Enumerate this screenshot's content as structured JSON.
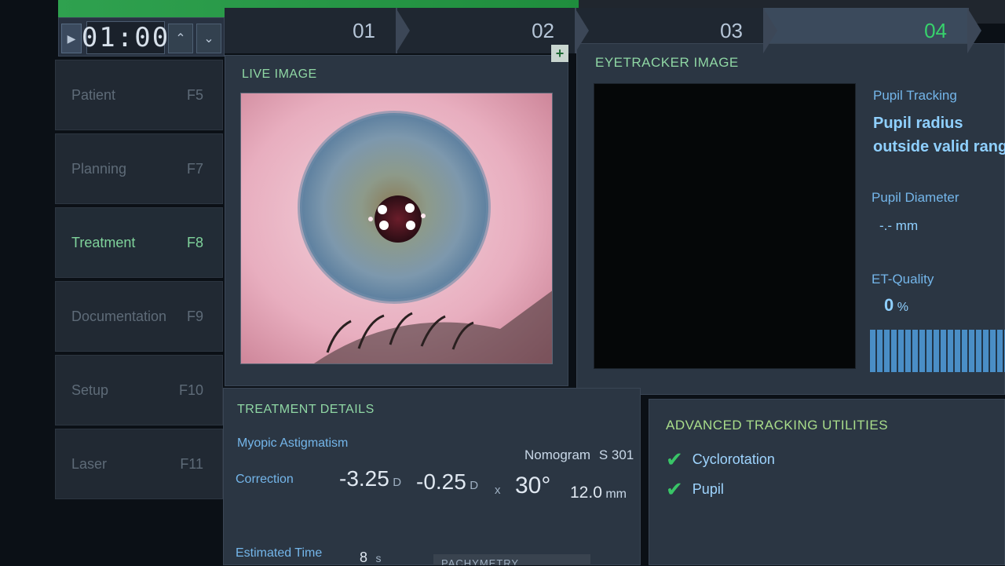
{
  "timer": {
    "value": "01:00",
    "play_icon": "play-icon",
    "up_icon": "chevron-up-icon",
    "down_icon": "chevron-down-icon"
  },
  "progress": {
    "fraction": 0.55
  },
  "steps": [
    {
      "label": "01"
    },
    {
      "label": "02"
    },
    {
      "label": "03"
    },
    {
      "label": "04"
    }
  ],
  "sidebar": {
    "items": [
      {
        "label": "Patient",
        "key": "F5"
      },
      {
        "label": "Planning",
        "key": "F7"
      },
      {
        "label": "Treatment",
        "key": "F8"
      },
      {
        "label": "Documentation",
        "key": "F9"
      },
      {
        "label": "Setup",
        "key": "F10"
      },
      {
        "label": "Laser",
        "key": "F11"
      }
    ],
    "active": "Treatment"
  },
  "live_image": {
    "title": "LIVE IMAGE",
    "plus_label": "+"
  },
  "eyetracker": {
    "title": "EYETRACKER IMAGE",
    "pupil_tracking_label": "Pupil Tracking",
    "pupil_tracking_status_1": "Pupil radius",
    "pupil_tracking_status_2": "outside valid range",
    "pupil_diameter_label": "Pupil Diameter",
    "pupil_diameter_value": "-.-",
    "pupil_diameter_unit": "mm",
    "et_quality_label": "ET-Quality",
    "et_quality_value": "0",
    "et_quality_unit": "%"
  },
  "treatment": {
    "title": "TREATMENT DETAILS",
    "type": "Myopic Astigmatism",
    "nomogram_label": "Nomogram",
    "nomogram_value": "S 301",
    "correction_label": "Correction",
    "sphere": "-3.25",
    "sphere_unit": "D",
    "cylinder": "-0.25",
    "cylinder_unit": "D",
    "times": "x",
    "axis": "30°",
    "zone": "12.0",
    "zone_unit": "mm",
    "estimated_time_label": "Estimated Time",
    "estimated_time_value": "8",
    "estimated_time_unit": "s",
    "pachymetry_label": "PACHYMETRY"
  },
  "tracking": {
    "title": "ADVANCED TRACKING UTILITIES",
    "items": [
      {
        "label": "Cyclorotation"
      },
      {
        "label": "Pupil"
      }
    ]
  },
  "colors": {
    "accent_green": "#37d26c",
    "accent_blue": "#74b6ea",
    "panel": "#2b3643"
  }
}
